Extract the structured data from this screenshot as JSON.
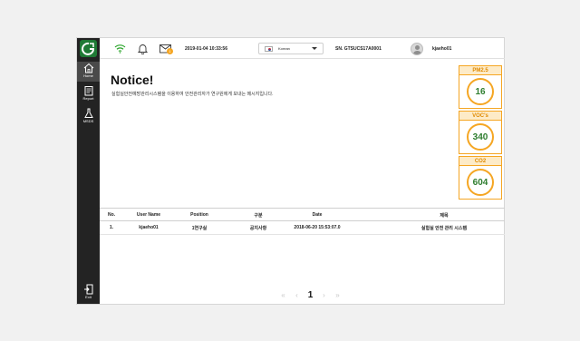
{
  "topbar": {
    "datetime": "2019-01-04 10:33:56",
    "language": "Korean",
    "serial": "SN. GTSUCS17A0001",
    "username": "kjaeho01",
    "notification_badge": "1"
  },
  "sidebar": {
    "items": [
      {
        "label": "Home",
        "icon": "home-icon"
      },
      {
        "label": "Report",
        "icon": "report-icon"
      },
      {
        "label": "MSDS",
        "icon": "flask-icon"
      },
      {
        "label": "Exit",
        "icon": "exit-icon"
      }
    ]
  },
  "notice": {
    "title": "Notice!",
    "body": "실험실안전예방관리시스템을 이용하여 안전관리자가 연구원에게 보내는 메시지입니다."
  },
  "sensors": [
    {
      "label": "PM2.5",
      "value": "16"
    },
    {
      "label": "VOC's",
      "value": "340"
    },
    {
      "label": "CO2",
      "value": "604"
    }
  ],
  "table": {
    "headers": [
      "No.",
      "User Name",
      "Position",
      "구분",
      "Date",
      "제목"
    ],
    "rows": [
      [
        "1.",
        "kjaeho01",
        "1연구실",
        "공지사항",
        "2018-06-20 15:53:07.0",
        "실험실 안전 관리 시스템"
      ]
    ]
  },
  "pagination": {
    "first": "«",
    "prev": "‹",
    "current": "1",
    "next": "›",
    "last": "»"
  },
  "colors": {
    "accent": "#f5a623",
    "sidebar": "#232323",
    "brand_green": "#1f7a35",
    "value_green": "#2e7d2e"
  }
}
